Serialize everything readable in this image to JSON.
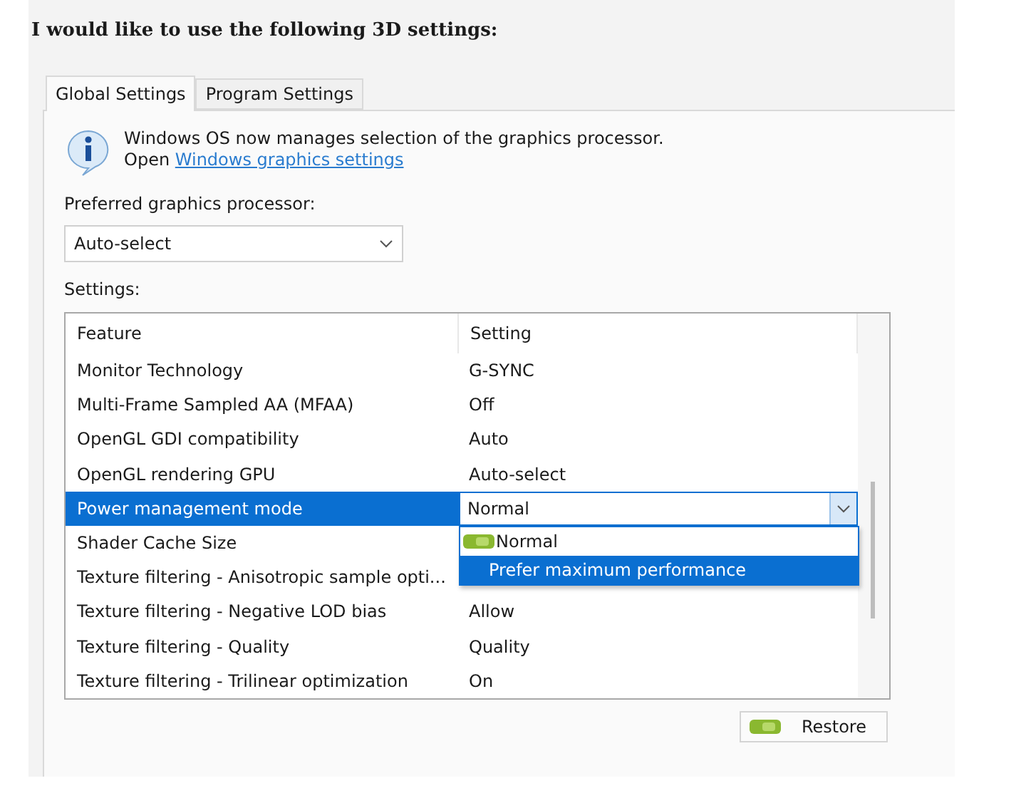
{
  "heading": "I would like to use the following 3D settings:",
  "tabs": [
    {
      "label": "Global Settings",
      "selected": true
    },
    {
      "label": "Program Settings",
      "selected": false
    }
  ],
  "info": {
    "text": "Windows OS now manages selection of the graphics processor.",
    "prefix": "Open",
    "link": "Windows graphics settings"
  },
  "preferred_processor": {
    "label": "Preferred graphics processor:",
    "value": "Auto-select"
  },
  "settings_label": "Settings:",
  "table": {
    "columns": [
      "Feature",
      "Setting"
    ],
    "rows": [
      {
        "feature": "Monitor Technology",
        "setting": "G-SYNC",
        "selected": false
      },
      {
        "feature": "Multi-Frame Sampled AA (MFAA)",
        "setting": "Off",
        "selected": false
      },
      {
        "feature": "OpenGL GDI compatibility",
        "setting": "Auto",
        "selected": false
      },
      {
        "feature": "OpenGL rendering GPU",
        "setting": "Auto-select",
        "selected": false
      },
      {
        "feature": "Power management mode",
        "setting": "Normal",
        "selected": true
      },
      {
        "feature": "Shader Cache Size",
        "selected": false
      },
      {
        "feature": "Texture filtering - Anisotropic sample opti...",
        "selected": false
      },
      {
        "feature": "Texture filtering - Negative LOD bias",
        "setting": "Allow",
        "selected": false
      },
      {
        "feature": "Texture filtering - Quality",
        "setting": "Quality",
        "selected": false
      },
      {
        "feature": "Texture filtering - Trilinear optimization",
        "setting": "On",
        "selected": false
      }
    ]
  },
  "dropdown_options": [
    {
      "label": "Normal",
      "current": true,
      "selected": false
    },
    {
      "label": "Prefer maximum performance",
      "current": false,
      "selected": true
    }
  ],
  "restore_button": "Restore"
}
